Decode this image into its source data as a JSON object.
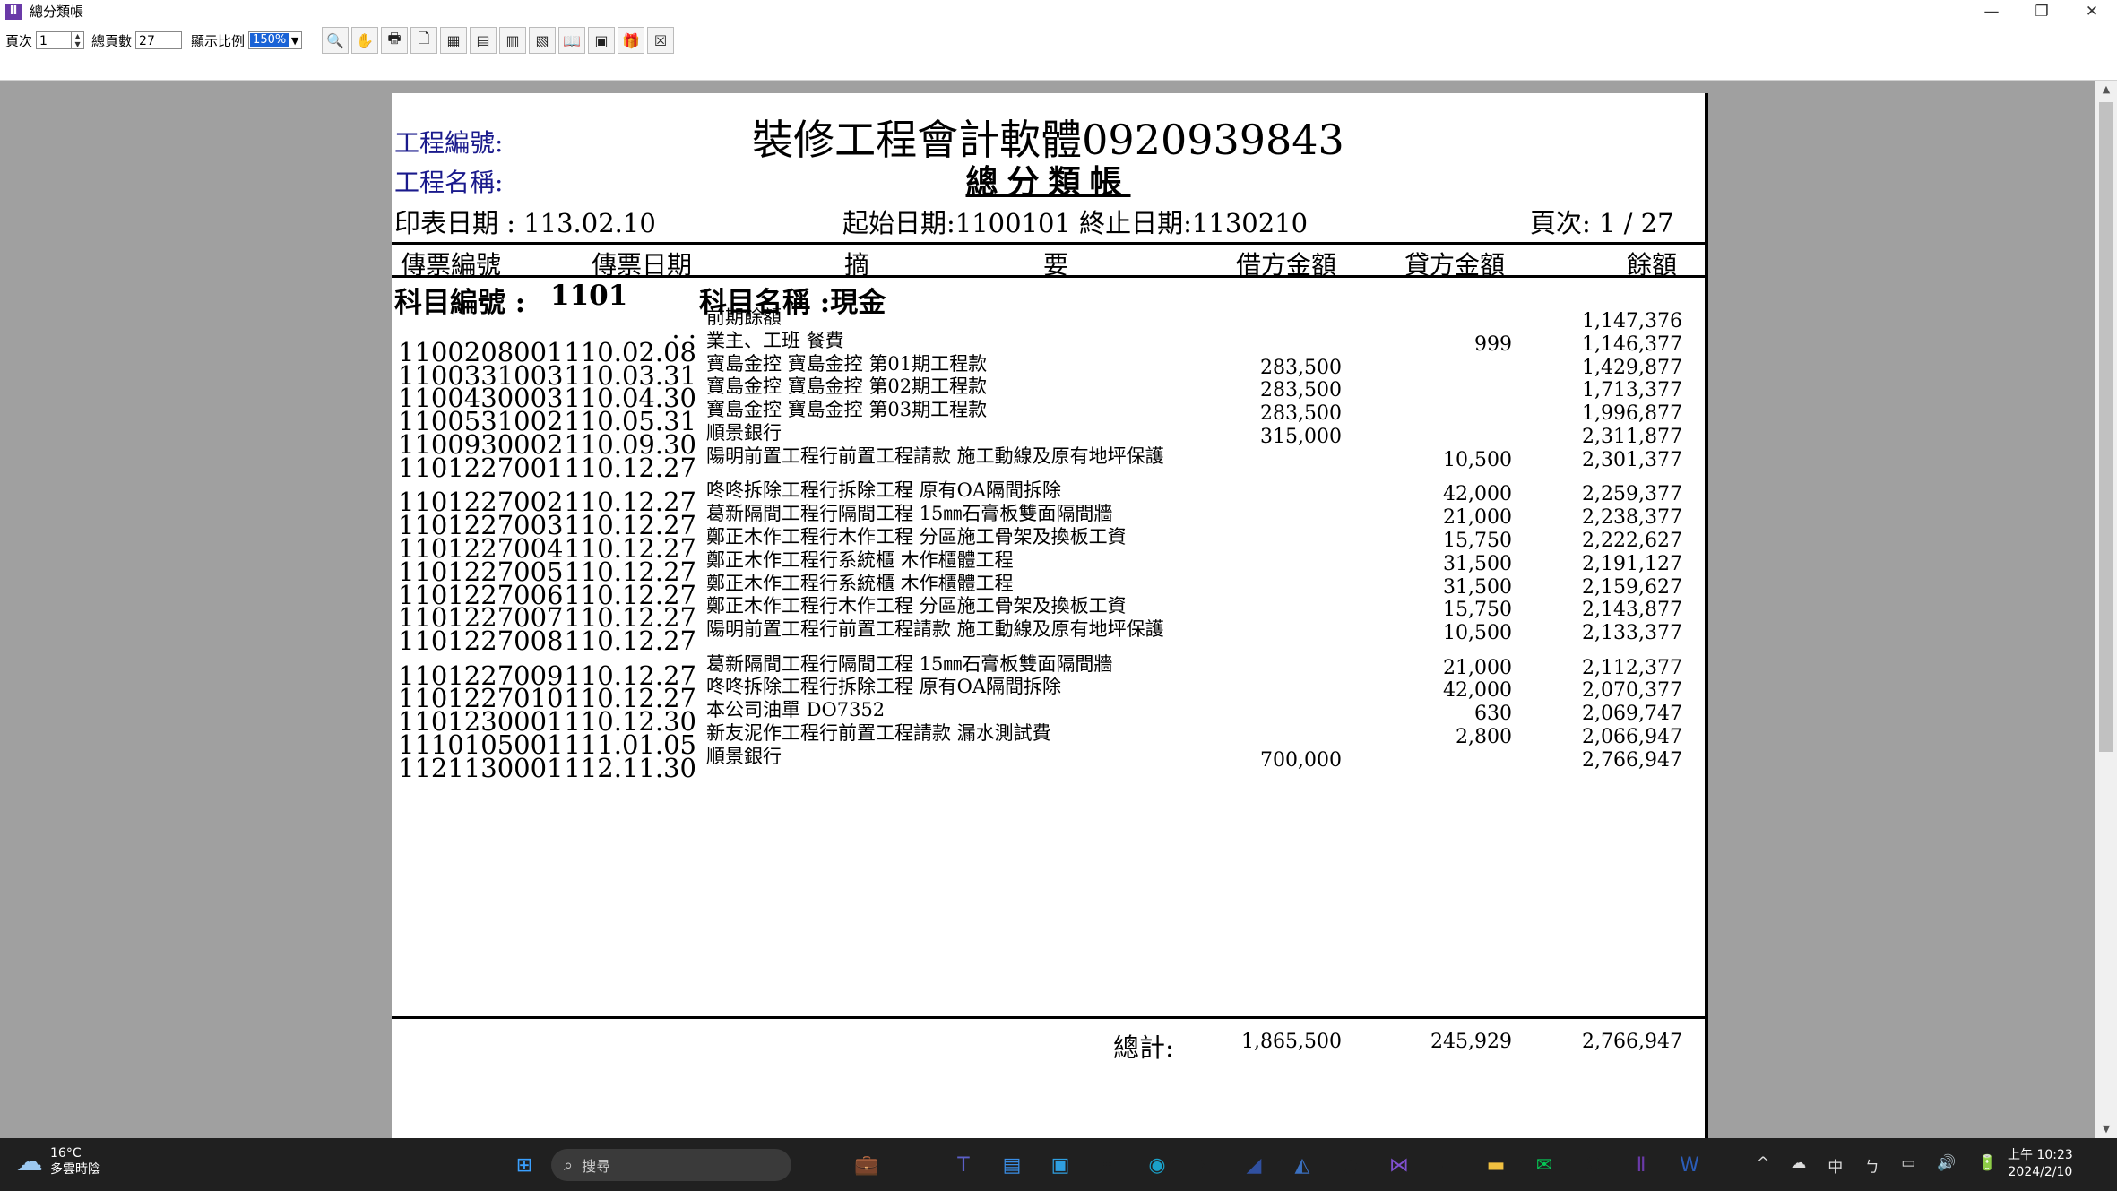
{
  "window": {
    "title": "總分類帳",
    "controls": [
      "—",
      "❐",
      "✕"
    ]
  },
  "toolbar": {
    "page_label": "頁次",
    "page_value": "1",
    "total_pages_label": "總頁數",
    "total_pages_value": "27",
    "zoom_label": "顯示比例",
    "zoom_value": "150%",
    "tools": [
      {
        "name": "zoom-icon",
        "glyph": "🔍"
      },
      {
        "name": "hand-icon",
        "glyph": "✋"
      },
      {
        "name": "print-icon",
        "glyph": "🖶"
      },
      {
        "name": "page-icon",
        "glyph": "🗋"
      },
      {
        "name": "export-excel-icon",
        "glyph": "▦"
      },
      {
        "name": "export-2-icon",
        "glyph": "▤"
      },
      {
        "name": "export-3-icon",
        "glyph": "▥"
      },
      {
        "name": "export-4-icon",
        "glyph": "▧"
      },
      {
        "name": "book-icon",
        "glyph": "📖"
      },
      {
        "name": "pdf-icon",
        "glyph": "▣"
      },
      {
        "name": "gift-icon",
        "glyph": "🎁"
      },
      {
        "name": "close-preview-icon",
        "glyph": "☒"
      }
    ]
  },
  "report": {
    "project_no_label": "工程編號:",
    "project_name_label": "工程名稱:",
    "title": "裝修工程會計軟體0920939843",
    "subtitle": "總分類帳",
    "print_date": "印表日期 : 113.02.10",
    "date_range": "起始日期:1100101 終止日期:1130210",
    "page_info": "頁次: 1 / 27",
    "col_voucher_no": "傳票編號",
    "col_voucher_date": "傳票日期",
    "col_desc_1": "摘",
    "col_desc_2": "要",
    "col_debit": "借方金額",
    "col_credit": "貸方金額",
    "col_balance": "餘額",
    "account_no_label": "科目編號 :",
    "account_no": "1101",
    "account_name_label": "科目名稱 :現金",
    "rows": [
      {
        "no": "",
        "date": ". .",
        "desc": "前期餘額",
        "debit": "",
        "credit": "",
        "balance": "1,147,376"
      },
      {
        "no": "1100208001",
        "date": "110.02.08",
        "desc": "業主、工班 餐費",
        "debit": "",
        "credit": "999",
        "balance": "1,146,377"
      },
      {
        "no": "1100331003",
        "date": "110.03.31",
        "desc": "寶島金控 寶島金控 第01期工程款",
        "debit": "283,500",
        "credit": "",
        "balance": "1,429,877"
      },
      {
        "no": "1100430003",
        "date": "110.04.30",
        "desc": "寶島金控 寶島金控 第02期工程款",
        "debit": "283,500",
        "credit": "",
        "balance": "1,713,377"
      },
      {
        "no": "1100531002",
        "date": "110.05.31",
        "desc": "寶島金控 寶島金控 第03期工程款",
        "debit": "283,500",
        "credit": "",
        "balance": "1,996,877"
      },
      {
        "no": "1100930002",
        "date": "110.09.30",
        "desc": "順景銀行",
        "debit": "315,000",
        "credit": "",
        "balance": "2,311,877"
      },
      {
        "no": "1101227001",
        "date": "110.12.27",
        "desc": "陽明前置工程行前置工程請款 施工動線及原有地坪保護",
        "debit": "",
        "credit": "10,500",
        "balance": "2,301,377",
        "tall": true
      },
      {
        "no": "1101227002",
        "date": "110.12.27",
        "desc": "咚咚拆除工程行拆除工程 原有OA隔間拆除",
        "debit": "",
        "credit": "42,000",
        "balance": "2,259,377"
      },
      {
        "no": "1101227003",
        "date": "110.12.27",
        "desc": "葛新隔間工程行隔間工程 15㎜石膏板雙面隔間牆",
        "debit": "",
        "credit": "21,000",
        "balance": "2,238,377"
      },
      {
        "no": "1101227004",
        "date": "110.12.27",
        "desc": "鄭正木作工程行木作工程 分區施工骨架及換板工資",
        "debit": "",
        "credit": "15,750",
        "balance": "2,222,627"
      },
      {
        "no": "1101227005",
        "date": "110.12.27",
        "desc": "鄭正木作工程行系統櫃 木作櫃體工程",
        "debit": "",
        "credit": "31,500",
        "balance": "2,191,127"
      },
      {
        "no": "1101227006",
        "date": "110.12.27",
        "desc": "鄭正木作工程行系統櫃 木作櫃體工程",
        "debit": "",
        "credit": "31,500",
        "balance": "2,159,627"
      },
      {
        "no": "1101227007",
        "date": "110.12.27",
        "desc": "鄭正木作工程行木作工程 分區施工骨架及換板工資",
        "debit": "",
        "credit": "15,750",
        "balance": "2,143,877"
      },
      {
        "no": "1101227008",
        "date": "110.12.27",
        "desc": "陽明前置工程行前置工程請款 施工動線及原有地坪保護",
        "debit": "",
        "credit": "10,500",
        "balance": "2,133,377",
        "tall": true
      },
      {
        "no": "1101227009",
        "date": "110.12.27",
        "desc": "葛新隔間工程行隔間工程 15㎜石膏板雙面隔間牆",
        "debit": "",
        "credit": "21,000",
        "balance": "2,112,377"
      },
      {
        "no": "1101227010",
        "date": "110.12.27",
        "desc": "咚咚拆除工程行拆除工程 原有OA隔間拆除",
        "debit": "",
        "credit": "42,000",
        "balance": "2,070,377"
      },
      {
        "no": "1101230001",
        "date": "110.12.30",
        "desc": "本公司油單 DO7352",
        "debit": "",
        "credit": "630",
        "balance": "2,069,747"
      },
      {
        "no": "1110105001",
        "date": "111.01.05",
        "desc": "新友泥作工程行前置工程請款 漏水測試費",
        "debit": "",
        "credit": "2,800",
        "balance": "2,066,947"
      },
      {
        "no": "1121130001",
        "date": "112.11.30",
        "desc": "順景銀行",
        "debit": "700,000",
        "credit": "",
        "balance": "2,766,947"
      }
    ],
    "total_label": "總計:",
    "total_debit": "1,865,500",
    "total_credit": "245,929",
    "total_balance": "2,766,947"
  },
  "taskbar": {
    "weather_temp": "16°C",
    "weather_desc": "多雲時陰",
    "search_placeholder": "搜尋",
    "apps": [
      {
        "name": "start-icon",
        "glyph": "⊞",
        "color": "#3aa0ff"
      },
      {
        "name": "search-spacer",
        "glyph": "",
        "color": "#202020"
      },
      {
        "name": "files-icon",
        "glyph": "",
        "color": "#202020"
      },
      {
        "name": "briefcase-icon",
        "glyph": "💼",
        "color": "#202020"
      },
      {
        "name": "task-view-icon",
        "glyph": "▭",
        "color": "#202020"
      },
      {
        "name": "teams-icon",
        "glyph": "T",
        "color": "#5b5fc7"
      },
      {
        "name": "notepad-icon",
        "glyph": "▤",
        "color": "#3a8ee6"
      },
      {
        "name": "photos-icon",
        "glyph": "▣",
        "color": "#2f9fe0"
      },
      {
        "name": "store-icon",
        "glyph": "▦",
        "color": "#202020"
      },
      {
        "name": "edge-icon",
        "glyph": "◉",
        "color": "#1aa0c8"
      },
      {
        "name": "chrome-icon",
        "glyph": "◎",
        "color": "#202020"
      },
      {
        "name": "app1-icon",
        "glyph": "◢",
        "color": "#3050a0"
      },
      {
        "name": "app2-icon",
        "glyph": "◭",
        "color": "#3a70c0"
      },
      {
        "name": "globe-icon",
        "glyph": "◍",
        "color": "#202020"
      },
      {
        "name": "vs-icon",
        "glyph": "⋈",
        "color": "#8050d0"
      },
      {
        "name": "tools-icon",
        "glyph": "✂",
        "color": "#202020"
      },
      {
        "name": "folder-icon",
        "glyph": "▬",
        "color": "#f0c040"
      },
      {
        "name": "line-icon",
        "glyph": "✉",
        "color": "#06c755"
      },
      {
        "name": "app3-icon",
        "glyph": "❂",
        "color": "#202020"
      },
      {
        "name": "accounting-app-icon",
        "glyph": "Ⅱ",
        "color": "#6a3aa8"
      },
      {
        "name": "word-icon",
        "glyph": "W",
        "color": "#2b5cb8"
      }
    ],
    "tray": [
      "^",
      "☁",
      "中",
      "ㄅ",
      "▭",
      "🔊",
      "🔋"
    ],
    "time": "上午 10:23",
    "date": "2024/2/10"
  }
}
